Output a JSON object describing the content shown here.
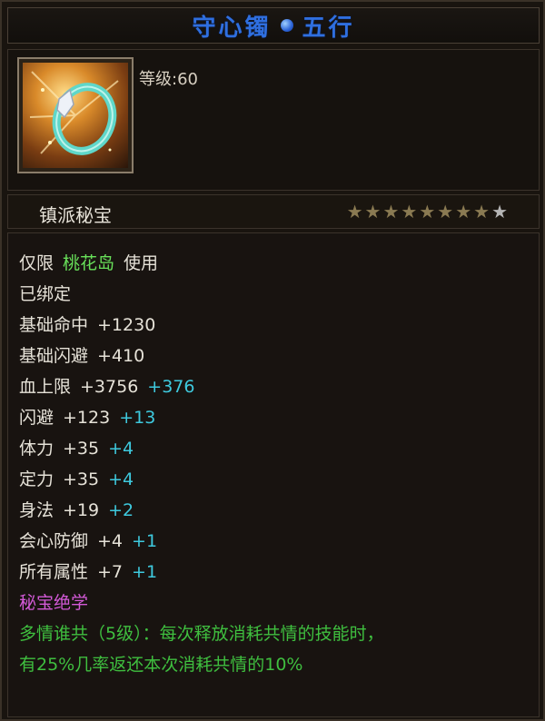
{
  "title": {
    "name": "守心镯",
    "attr": "五行"
  },
  "item": {
    "level_label": "等级:60",
    "icon": "jade-bracelet-icon"
  },
  "category": {
    "label": "镇派秘宝",
    "stars_total": 9,
    "stars_filled": 8
  },
  "restriction": {
    "prefix": "仅限",
    "sect": "桃花岛",
    "suffix": "使用"
  },
  "bound": "已绑定",
  "stats": [
    {
      "name": "基础命中",
      "base": "+1230",
      "bonus": ""
    },
    {
      "name": "基础闪避",
      "base": "+410",
      "bonus": ""
    },
    {
      "name": "血上限",
      "base": "+3756",
      "bonus": "+376"
    },
    {
      "name": "闪避",
      "base": "+123",
      "bonus": "+13"
    },
    {
      "name": "体力",
      "base": "+35",
      "bonus": "+4"
    },
    {
      "name": "定力",
      "base": "+35",
      "bonus": "+4"
    },
    {
      "name": "身法",
      "base": "+19",
      "bonus": "+2"
    },
    {
      "name": "会心防御",
      "base": "+4",
      "bonus": "+1"
    },
    {
      "name": "所有属性",
      "base": "+7",
      "bonus": "+1"
    }
  ],
  "skill": {
    "header": "秘宝绝学",
    "line1": "多情谁共（5级）：每次释放消耗共情的技能时，",
    "line2": "有25%几率返还本次消耗共情的10%"
  },
  "colors": {
    "title": "#2f6fe0",
    "sect_green": "#68e05a",
    "bonus_cyan": "#3ec9de",
    "skill_header": "#d45ad8",
    "skill_text": "#3fbf3f"
  }
}
